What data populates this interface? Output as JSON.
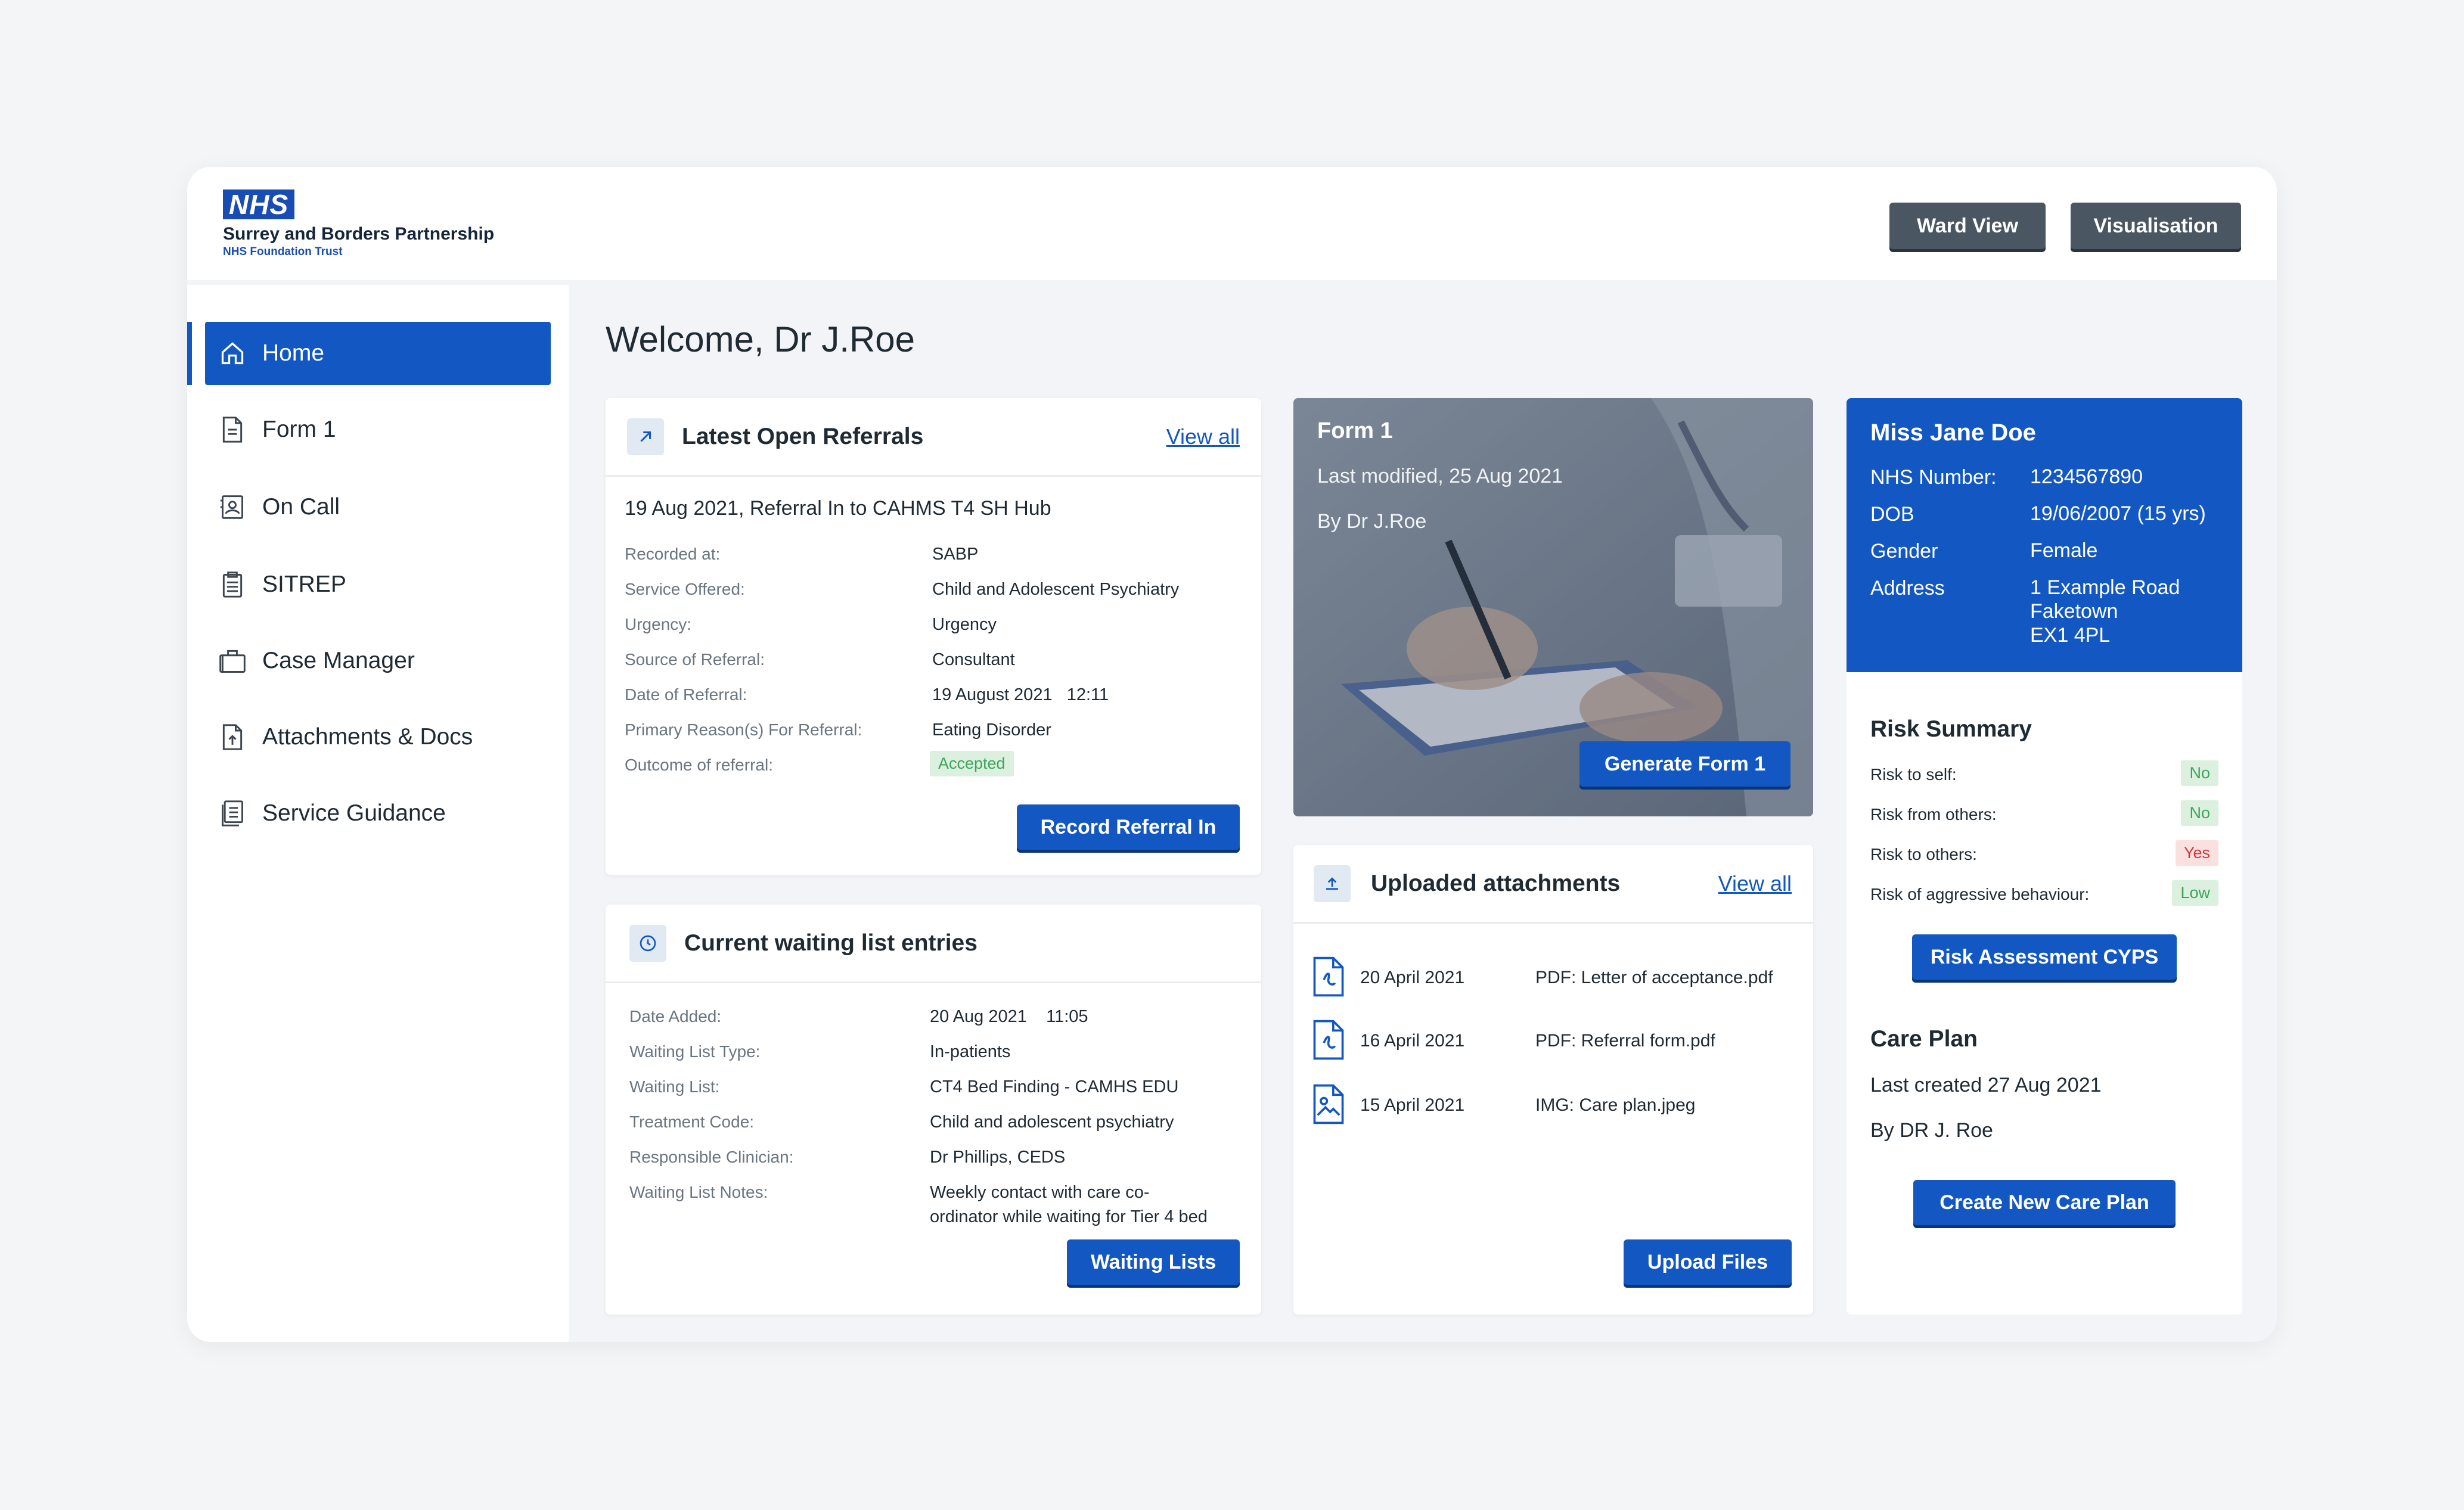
{
  "header": {
    "logo_badge": "NHS",
    "org_name": "Surrey and Borders Partnership",
    "org_sub": "NHS Foundation Trust",
    "ward_view_label": "Ward View",
    "visualisation_label": "Visualisation"
  },
  "sidebar": {
    "items": [
      {
        "label": "Home",
        "icon": "home-icon",
        "active": true
      },
      {
        "label": "Form 1",
        "icon": "document-icon"
      },
      {
        "label": "On Call",
        "icon": "on-call-icon"
      },
      {
        "label": "SITREP",
        "icon": "clipboard-icon"
      },
      {
        "label": "Case Manager",
        "icon": "briefcase-icon"
      },
      {
        "label": "Attachments & Docs",
        "icon": "upload-document-icon"
      },
      {
        "label": "Service Guidance",
        "icon": "guidance-icon"
      }
    ]
  },
  "welcome": "Welcome, Dr J.Roe",
  "referrals": {
    "title": "Latest Open Referrals",
    "view_all": "View all",
    "heading": "19 Aug 2021, Referral In to CAHMS T4 SH Hub",
    "rows": [
      {
        "label": "Recorded at:",
        "value": "SABP"
      },
      {
        "label": "Service Offered:",
        "value": "Child and Adolescent Psychiatry"
      },
      {
        "label": "Urgency:",
        "value": "Urgency"
      },
      {
        "label": "Source of Referral:",
        "value": "Consultant"
      },
      {
        "label": "Date of Referral:",
        "value": "19 August 2021   12:11"
      },
      {
        "label": "Primary Reason(s) For Referral:",
        "value": "Eating Disorder"
      },
      {
        "label": "Outcome of referral:",
        "value": "Accepted"
      }
    ],
    "button": "Record Referral In"
  },
  "waiting": {
    "title": "Current waiting list entries",
    "rows": [
      {
        "label": "Date Added:",
        "value": "20 Aug 2021    11:05"
      },
      {
        "label": "Waiting List Type:",
        "value": "In-patients"
      },
      {
        "label": "Waiting List:",
        "value": "CT4 Bed Finding - CAMHS EDU"
      },
      {
        "label": "Treatment Code:",
        "value": "Child and adolescent psychiatry"
      },
      {
        "label": "Responsible Clinician:",
        "value": "Dr Phillips, CEDS"
      },
      {
        "label": "Waiting List Notes:",
        "value": "Weekly contact with care co-"
      },
      {
        "label": "",
        "value": "ordinator while waiting for Tier 4 bed"
      }
    ],
    "button": "Waiting Lists"
  },
  "form1": {
    "title": "Form 1",
    "modified": "Last modified, 25 Aug 2021",
    "by": "By Dr J.Roe",
    "button": "Generate Form 1"
  },
  "attachments": {
    "title": "Uploaded attachments",
    "view_all": "View all",
    "files": [
      {
        "date": "20 April 2021",
        "name": "PDF: Letter of acceptance.pdf",
        "icon": "pdf-file-icon"
      },
      {
        "date": "16 April 2021",
        "name": "PDF: Referral form.pdf",
        "icon": "pdf-file-icon"
      },
      {
        "date": "15 April 2021",
        "name": "IMG: Care plan.jpeg",
        "icon": "image-file-icon"
      }
    ],
    "button": "Upload Files"
  },
  "patient": {
    "name": "Miss Jane Doe",
    "fields": [
      {
        "label": "NHS Number:",
        "value": "1234567890"
      },
      {
        "label": "DOB",
        "value": "19/06/2007 (15 yrs)"
      },
      {
        "label": "Gender",
        "value": "Female"
      },
      {
        "label": "Address",
        "value": "1 Example Road"
      }
    ],
    "address_line2": "Faketown",
    "address_line3": "EX1 4PL"
  },
  "risk": {
    "title": "Risk Summary",
    "rows": [
      {
        "label": "Risk to self:",
        "value": "No",
        "status": "green"
      },
      {
        "label": "Risk from others:",
        "value": "No",
        "status": "green"
      },
      {
        "label": "Risk to others:",
        "value": "Yes",
        "status": "red"
      },
      {
        "label": "Risk of aggressive behaviour:",
        "value": "Low",
        "status": "green"
      }
    ],
    "button": "Risk Assessment CYPS"
  },
  "care_plan": {
    "title": "Care Plan",
    "created": "Last created 27 Aug 2021",
    "by": "By DR J. Roe",
    "button": "Create New Care Plan"
  },
  "colors": {
    "primary": "#1358c2",
    "dark_button": "#4a5763",
    "nhs_blue": "#1a4db3",
    "green_badge": "#3da35a",
    "red_badge": "#d0383a"
  }
}
